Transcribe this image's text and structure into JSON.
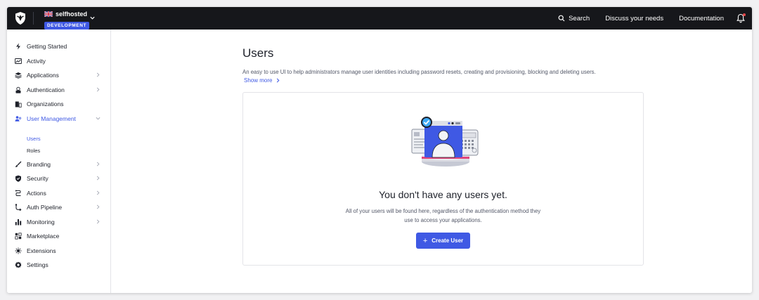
{
  "topbar": {
    "tenant_name": "selfhosted",
    "environment": "DEVELOPMENT",
    "search_label": "Search",
    "discuss_label": "Discuss your needs",
    "docs_label": "Documentation",
    "icons": [
      "auth0-shield-logo",
      "uk-flag-icon",
      "chevron-down-icon",
      "search-icon",
      "bell-icon"
    ]
  },
  "sidebar": {
    "items": [
      {
        "label": "Getting Started",
        "icon": "lightning-icon"
      },
      {
        "label": "Activity",
        "icon": "activity-chart-icon"
      },
      {
        "label": "Applications",
        "icon": "layers-icon"
      },
      {
        "label": "Authentication",
        "icon": "lock-user-icon"
      },
      {
        "label": "Organizations",
        "icon": "building-icon"
      },
      {
        "label": "User Management",
        "icon": "users-icon"
      },
      {
        "label": "Branding",
        "icon": "brush-icon"
      },
      {
        "label": "Security",
        "icon": "shield-icon"
      },
      {
        "label": "Actions",
        "icon": "actions-icon"
      },
      {
        "label": "Auth Pipeline",
        "icon": "pipeline-icon"
      },
      {
        "label": "Monitoring",
        "icon": "bar-chart-icon"
      },
      {
        "label": "Marketplace",
        "icon": "grid-icon"
      },
      {
        "label": "Extensions",
        "icon": "extensions-icon"
      },
      {
        "label": "Settings",
        "icon": "gear-icon"
      }
    ],
    "subitems": [
      {
        "label": "Users"
      },
      {
        "label": "Roles"
      }
    ]
  },
  "main": {
    "title": "Users",
    "description": "An easy to use UI to help administrators manage user identities including password resets, creating and provisioning, blocking and deleting users.",
    "show_more": "Show more",
    "empty_title": "You don't have any users yet.",
    "empty_description": "All of your users will be found here, regardless of the authentication method they use to access your applications.",
    "create_plus": "+",
    "create_label": "Create User"
  },
  "colors": {
    "accent": "#3f59e4",
    "topbar": "#16171b",
    "notification": "#e8484a"
  }
}
